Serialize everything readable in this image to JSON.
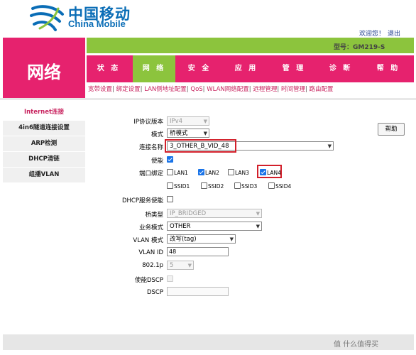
{
  "brand": {
    "name_cn": "中国移动",
    "name_en": "China Mobile"
  },
  "header": {
    "welcome": "欢迎您！",
    "logout": "退出",
    "model": "型号：GM219-S"
  },
  "section_title": "网络",
  "nav": [
    "状 态",
    "网 络",
    "安 全",
    "应 用",
    "管 理",
    "诊 断",
    "帮 助"
  ],
  "subnav": [
    "宽带设置",
    "绑定设置",
    "LAN侧地址配置",
    "QoS",
    "WLAN网络配置",
    "远程管理",
    "时间管理",
    "路由配置"
  ],
  "sidebar": [
    "Internet连接",
    "4in6隧道连接设置",
    "ARP检测",
    "DHCP清链",
    "组播VLAN"
  ],
  "help_button": "帮助",
  "form": {
    "ip_version": {
      "label": "IP协议版本",
      "value": "IPv4"
    },
    "mode": {
      "label": "模式",
      "value": "桥模式"
    },
    "connection_name": {
      "label": "连接名称",
      "value": "3_OTHER_B_VID_48"
    },
    "enable": {
      "label": "使能",
      "checked": true
    },
    "port_binding": {
      "label": "端口绑定",
      "ports": [
        {
          "name": "LAN1",
          "checked": false
        },
        {
          "name": "LAN2",
          "checked": true
        },
        {
          "name": "LAN3",
          "checked": false
        },
        {
          "name": "LAN4",
          "checked": true
        },
        {
          "name": "SSID1",
          "checked": false
        },
        {
          "name": "SSID2",
          "checked": false
        },
        {
          "name": "SSID3",
          "checked": false
        },
        {
          "name": "SSID4",
          "checked": false
        }
      ]
    },
    "dhcp_enable": {
      "label": "DHCP服务使能",
      "checked": false
    },
    "bridge_type": {
      "label": "桥类型",
      "value": "IP_BRIDGED"
    },
    "service_mode": {
      "label": "业务模式",
      "value": "OTHER"
    },
    "vlan_mode": {
      "label": "VLAN 模式",
      "value": "改写(tag)"
    },
    "vlan_id": {
      "label": "VLAN ID",
      "value": "48"
    },
    "priority": {
      "label": "802.1p",
      "value": "5"
    },
    "dscp_enable": {
      "label": "使能DSCP",
      "checked": false
    },
    "dscp": {
      "label": "DSCP",
      "value": ""
    }
  },
  "watermark": "值 什么值得买",
  "colors": {
    "brand_pink": "#e6226e",
    "brand_green": "#8cc43d",
    "brand_blue": "#0a6db6",
    "highlight_red": "#d21f2a"
  }
}
